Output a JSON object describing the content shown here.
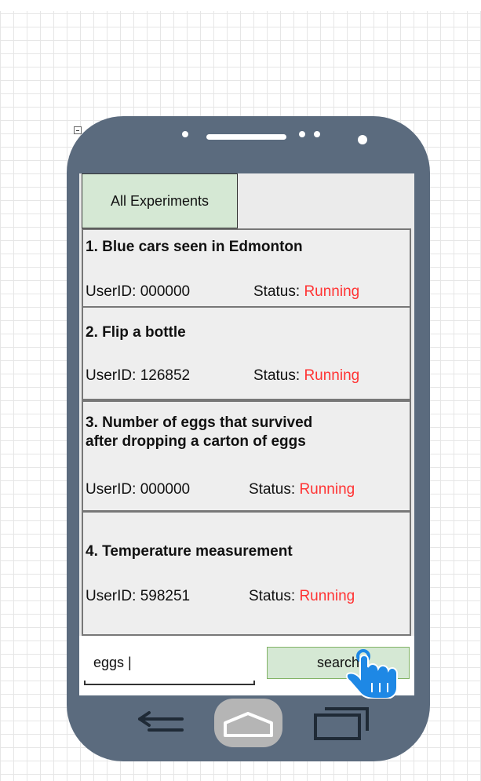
{
  "tab": {
    "label": "All Experiments"
  },
  "experiments": [
    {
      "title_lines": [
        "1. Blue cars seen in Edmonton"
      ],
      "user_label": "UserID:",
      "user_id": "000000",
      "status_label": "Status:",
      "status": "Running"
    },
    {
      "title_lines": [
        "2. Flip a bottle"
      ],
      "user_label": "UserID:",
      "user_id": "126852",
      "status_label": "Status:",
      "status": "Running"
    },
    {
      "title_lines": [
        "3. Number of eggs that survived",
        "after dropping a carton of eggs"
      ],
      "user_label": "UserID:",
      "user_id": "000000",
      "status_label": "Status:",
      "status": "Running"
    },
    {
      "title_lines": [
        "4. Temperature measurement"
      ],
      "user_label": "UserID:",
      "user_id": "598251",
      "status_label": "Status:",
      "status": "Running"
    }
  ],
  "search": {
    "value": "eggs |",
    "button_label": "search"
  },
  "colors": {
    "phone_body": "#5b6b7e",
    "tab_fill": "#d5e8d4",
    "button_fill": "#d5e8d4",
    "button_border": "#82b366",
    "status_running": "#ff3333",
    "pointer_hand": "#1e88e5"
  },
  "icons": {
    "back": "back-arrow-icon",
    "home": "home-icon",
    "recents": "recent-apps-icon",
    "pointer": "hand-pointer-icon"
  }
}
